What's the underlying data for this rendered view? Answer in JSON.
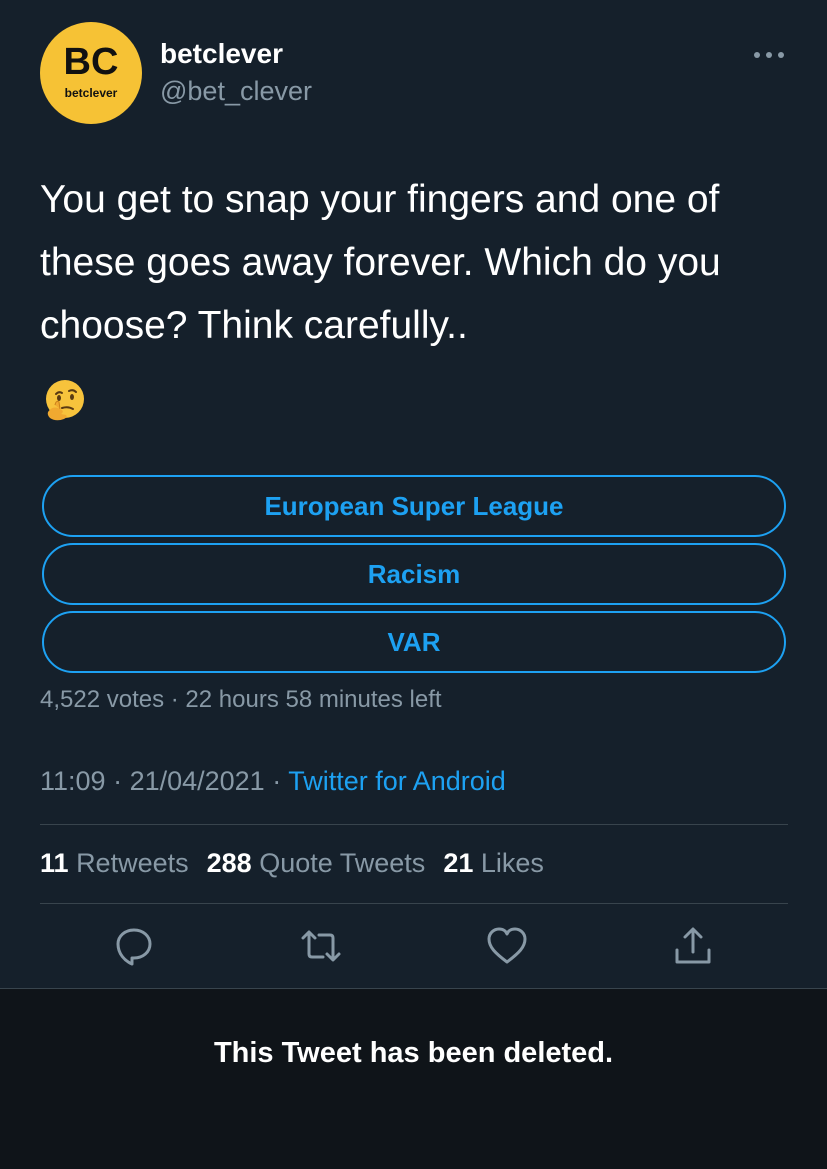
{
  "colors": {
    "background": "#15202b",
    "accent": "#1da1f2",
    "secondary_text": "#8899a6",
    "avatar_bg": "#f6c235",
    "banner_bg": "#0f1419"
  },
  "author": {
    "avatar_big": "BC",
    "avatar_small": "betclever",
    "display_name": "betclever",
    "handle": "@bet_clever"
  },
  "tweet": {
    "text": "You get to snap your fingers and one of\nthese goes away forever. Which do you\nchoose? Think carefully..",
    "emoji_icon": "thinking-face-emoji"
  },
  "poll": {
    "options": [
      {
        "label": "European Super League"
      },
      {
        "label": "Racism"
      },
      {
        "label": "VAR"
      }
    ],
    "votes": "4,522 votes",
    "separator": " · ",
    "time_left": "22 hours 58 minutes left"
  },
  "meta": {
    "time": "11:09",
    "date": "21/04/2021",
    "separator": " · ",
    "source": "Twitter for Android"
  },
  "stats": {
    "retweets_count": "11",
    "retweets_label": "Retweets",
    "quotes_count": "288",
    "quotes_label": "Quote Tweets",
    "likes_count": "21",
    "likes_label": "Likes"
  },
  "actions": [
    "reply-icon",
    "retweet-icon",
    "like-icon",
    "share-icon"
  ],
  "banner": {
    "message": "This Tweet has been deleted."
  }
}
